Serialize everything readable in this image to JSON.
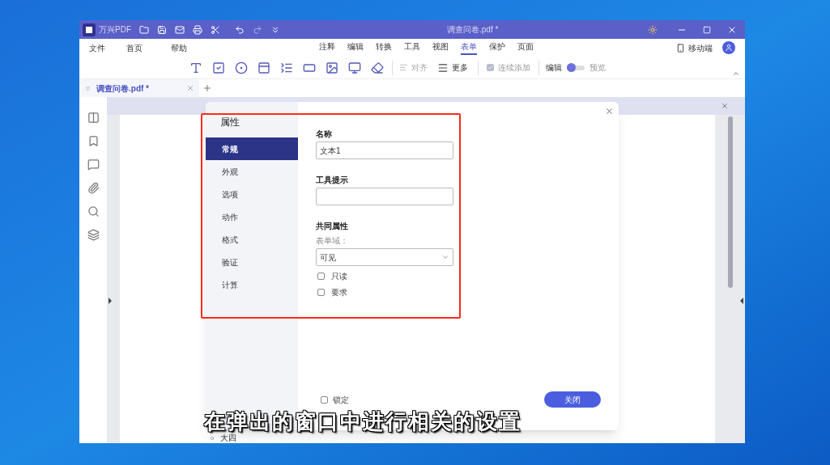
{
  "window": {
    "app_name": "万兴PDF",
    "title": "调查问卷.pdf *"
  },
  "menu_left": [
    {
      "label": "文件"
    },
    {
      "label": "首页"
    },
    {
      "label": "帮助"
    }
  ],
  "menu_tabs": [
    {
      "label": "注释",
      "selected": false
    },
    {
      "label": "编辑",
      "selected": false
    },
    {
      "label": "转换",
      "selected": false
    },
    {
      "label": "工具",
      "selected": false
    },
    {
      "label": "视图",
      "selected": false
    },
    {
      "label": "表单",
      "selected": true
    },
    {
      "label": "保护",
      "selected": false
    },
    {
      "label": "页面",
      "selected": false
    }
  ],
  "mobile_label": "移动端",
  "toolbar": {
    "align_label": "对齐",
    "more_label": "更多",
    "continuous_add": {
      "label": "连续添加",
      "checked": true
    },
    "mode": {
      "left_label": "编辑",
      "right_label": "预览",
      "preview": false
    }
  },
  "document_tab": {
    "label": "调查问卷.pdf *"
  },
  "document": {
    "bullet_text": "大四"
  },
  "dialog": {
    "title": "属性",
    "nav": [
      {
        "label": "常规",
        "selected": true
      },
      {
        "label": "外观",
        "selected": false
      },
      {
        "label": "选项",
        "selected": false
      },
      {
        "label": "动作",
        "selected": false
      },
      {
        "label": "格式",
        "selected": false
      },
      {
        "label": "验证",
        "selected": false
      },
      {
        "label": "计算",
        "selected": false
      }
    ],
    "name_label": "名称",
    "name_value": "文本1",
    "tooltip_label": "工具提示",
    "common_label": "共同属性",
    "form_field_label": "表单域：",
    "visibility_value": "可见",
    "checkboxes": [
      {
        "label": "只读",
        "checked": false
      },
      {
        "label": "要求",
        "checked": false
      }
    ],
    "lock": {
      "label": "锁定",
      "checked": false
    },
    "close_button": "关闭"
  },
  "caption": "在弹出的窗口中进行相关的设置"
}
